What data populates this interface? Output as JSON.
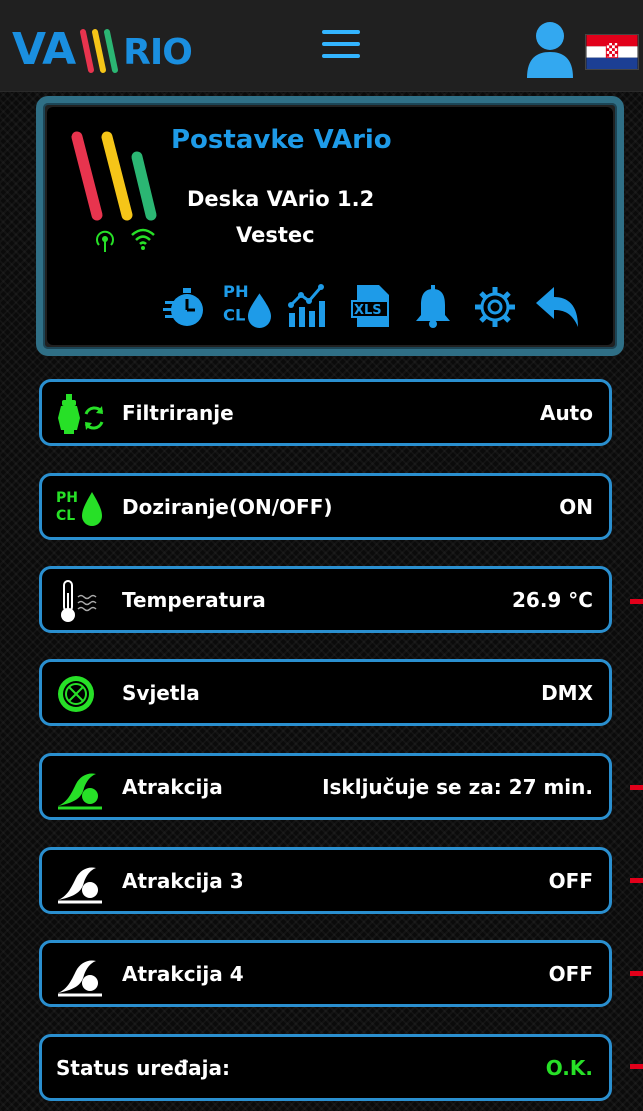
{
  "header": {
    "logo_text": "VA",
    "logo_text_small": "RIO",
    "menu_icon": "hamburger-menu-icon",
    "user_icon": "user-icon",
    "language_flag": "croatia-flag-icon"
  },
  "panel": {
    "title": "Postavke VArio",
    "board": "Deska VArio 1.2",
    "location": "Vestec",
    "status_icons": [
      "signal-icon",
      "wifi-icon"
    ],
    "toolbar_icons": [
      "timer-icon",
      "ph-cl-dosing-icon",
      "statistics-chart-icon",
      "xls-export-icon",
      "bell-icon",
      "gear-icon",
      "back-arrow-icon"
    ],
    "toolbar_ph": "PH",
    "toolbar_cl": "CL",
    "toolbar_xls": "XLS"
  },
  "rows": [
    {
      "label": "Filtriranje",
      "value": "Auto",
      "icon": "pump-filter-icon"
    },
    {
      "label": "Doziranje(ON/OFF)",
      "value": "ON",
      "icon": "ph-cl-drop-icon",
      "icon_ph": "PH",
      "icon_cl": "CL"
    },
    {
      "label": "Temperatura",
      "value": "26.9 °C",
      "icon": "thermometer-water-icon"
    },
    {
      "label": "Svjetla",
      "value": "DMX",
      "icon": "light-icon"
    },
    {
      "label": "Atrakcija",
      "value": "Isključuje se za: 27 min.",
      "icon": "wave-green-icon"
    },
    {
      "label": "Atrakcija 3",
      "value": "OFF",
      "icon": "wave-white-icon"
    },
    {
      "label": "Atrakcija 4",
      "value": "OFF",
      "icon": "wave-white-icon"
    },
    {
      "label": "Status uređaja:",
      "value": "O.K."
    }
  ],
  "colors": {
    "accent_blue": "#1e9be8",
    "row_border": "#2a8fcf",
    "active_green": "#27e027",
    "indicator_red": "#e2001a",
    "stripe_red": "#e8344e",
    "stripe_yellow": "#f5c518",
    "stripe_green": "#2bb673"
  }
}
